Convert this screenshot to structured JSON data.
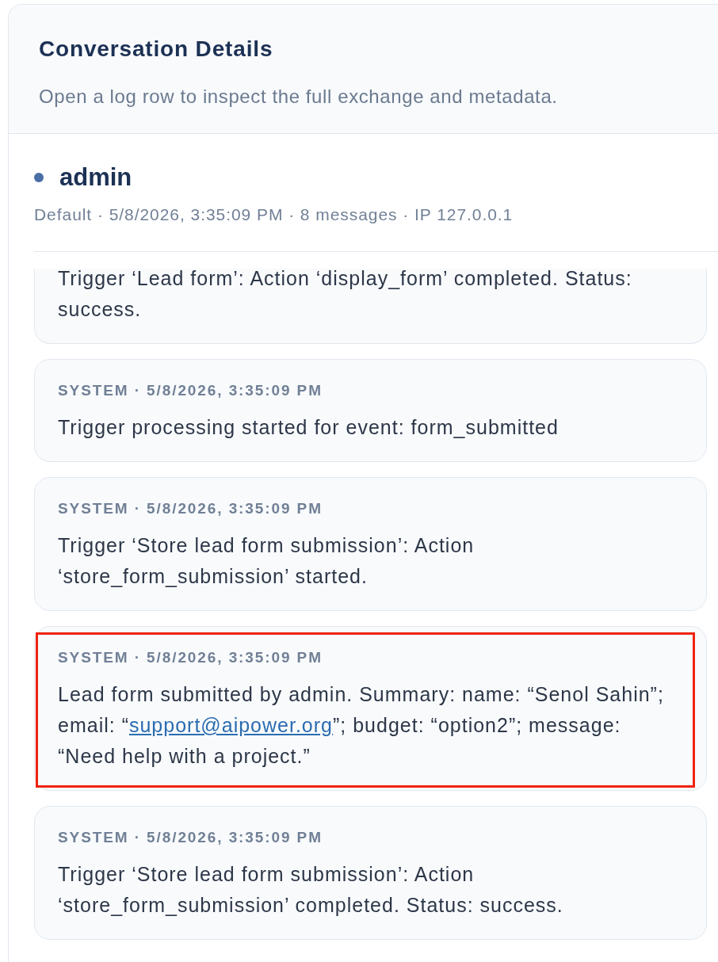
{
  "panel": {
    "title": "Conversation Details",
    "subtitle": "Open a log row to inspect the full exchange and metadata."
  },
  "conversation": {
    "user": "admin",
    "meta": "Default · 5/8/2026, 3:35:09 PM · 8 messages · IP 127.0.0.1"
  },
  "messages": [
    {
      "segments": [
        {
          "kind": "text",
          "text": "Trigger ‘Lead form’: Action ‘display_form’ completed. Status: success."
        }
      ],
      "highlighted": false
    },
    {
      "header": "SYSTEM · 5/8/2026, 3:35:09 PM",
      "segments": [
        {
          "kind": "text",
          "text": "Trigger processing started for event: form_submitted"
        }
      ],
      "highlighted": false
    },
    {
      "header": "SYSTEM · 5/8/2026, 3:35:09 PM",
      "segments": [
        {
          "kind": "text",
          "text": "Trigger ‘Store lead form submission’: Action ‘store_form_submission’ started."
        }
      ],
      "highlighted": false
    },
    {
      "header": "SYSTEM · 5/8/2026, 3:35:09 PM",
      "segments": [
        {
          "kind": "text",
          "text": "Lead form submitted by admin. Summary: name: “Senol Sahin”; email: “"
        },
        {
          "kind": "link",
          "text": "support@aipower.org"
        },
        {
          "kind": "text",
          "text": "”; budget: “option2”; message: “Need help with a project.”"
        }
      ],
      "highlighted": true
    },
    {
      "header": "SYSTEM · 5/8/2026, 3:35:09 PM",
      "segments": [
        {
          "kind": "text",
          "text": "Trigger ‘Store lead form submission’: Action ‘store_form_submission’ completed. Status: success."
        }
      ],
      "highlighted": false
    }
  ]
}
